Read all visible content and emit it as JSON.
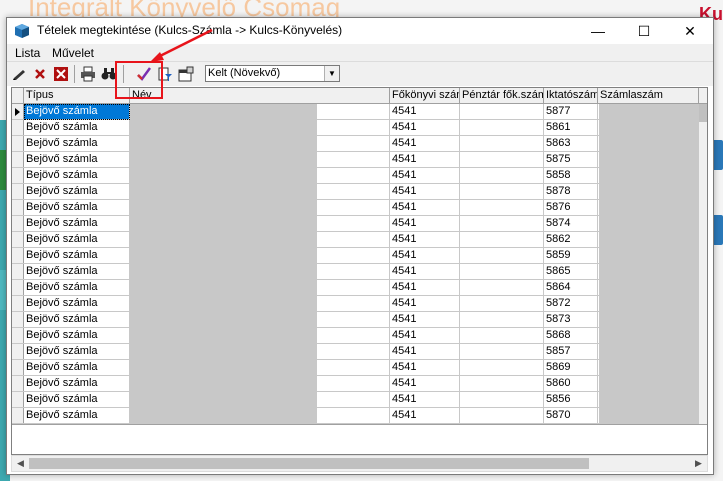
{
  "window": {
    "title": "Tételek megtekintése (Kulcs-Számla -> Kulcs-Könyvelés)",
    "minimize_glyph": "—",
    "maximize_glyph": "☐",
    "close_glyph": "✕"
  },
  "background_app": {
    "title_partial": "Integrált Könyvelő Csomag",
    "logo_partial": "Ku"
  },
  "menu": [
    {
      "label": "Lista"
    },
    {
      "label": "Művelet"
    }
  ],
  "toolbar": {
    "icons": [
      "edit-pen-icon",
      "delete-x-icon",
      "delete-red-icon",
      "print-icon",
      "find-binoculars-icon",
      "checkmark-icon",
      "filter-icon",
      "properties-icon"
    ],
    "sort_select": {
      "value": "Kelt (Növekvő)"
    }
  },
  "table": {
    "columns": [
      "Típus",
      "Név",
      "Főkönyvi szám",
      "Pénztár fők.szám",
      "Iktatószám",
      "Számlaszám"
    ],
    "rows": [
      {
        "tipus": "Bejövő számla",
        "fokonyvi": "4541",
        "iktato": "5877"
      },
      {
        "tipus": "Bejövő számla",
        "fokonyvi": "4541",
        "iktato": "5861"
      },
      {
        "tipus": "Bejövő számla",
        "fokonyvi": "4541",
        "iktato": "5863"
      },
      {
        "tipus": "Bejövő számla",
        "fokonyvi": "4541",
        "iktato": "5875"
      },
      {
        "tipus": "Bejövő számla",
        "fokonyvi": "4541",
        "iktato": "5858"
      },
      {
        "tipus": "Bejövő számla",
        "fokonyvi": "4541",
        "iktato": "5878"
      },
      {
        "tipus": "Bejövő számla",
        "fokonyvi": "4541",
        "iktato": "5876"
      },
      {
        "tipus": "Bejövő számla",
        "fokonyvi": "4541",
        "iktato": "5874"
      },
      {
        "tipus": "Bejövő számla",
        "fokonyvi": "4541",
        "iktato": "5862"
      },
      {
        "tipus": "Bejövő számla",
        "fokonyvi": "4541",
        "iktato": "5859"
      },
      {
        "tipus": "Bejövő számla",
        "fokonyvi": "4541",
        "iktato": "5865"
      },
      {
        "tipus": "Bejövő számla",
        "fokonyvi": "4541",
        "iktato": "5864"
      },
      {
        "tipus": "Bejövő számla",
        "fokonyvi": "4541",
        "iktato": "5872"
      },
      {
        "tipus": "Bejövő számla",
        "fokonyvi": "4541",
        "iktato": "5873"
      },
      {
        "tipus": "Bejövő számla",
        "fokonyvi": "4541",
        "iktato": "5868"
      },
      {
        "tipus": "Bejövő számla",
        "fokonyvi": "4541",
        "iktato": "5857"
      },
      {
        "tipus": "Bejövő számla",
        "fokonyvi": "4541",
        "iktato": "5869"
      },
      {
        "tipus": "Bejövő számla",
        "fokonyvi": "4541",
        "iktato": "5860"
      },
      {
        "tipus": "Bejövő számla",
        "fokonyvi": "4541",
        "iktato": "5856"
      },
      {
        "tipus": "Bejövő számla",
        "fokonyvi": "4541",
        "iktato": "5870"
      }
    ]
  },
  "colors": {
    "selection": "#0078d7",
    "annotation": "#e8141b"
  }
}
